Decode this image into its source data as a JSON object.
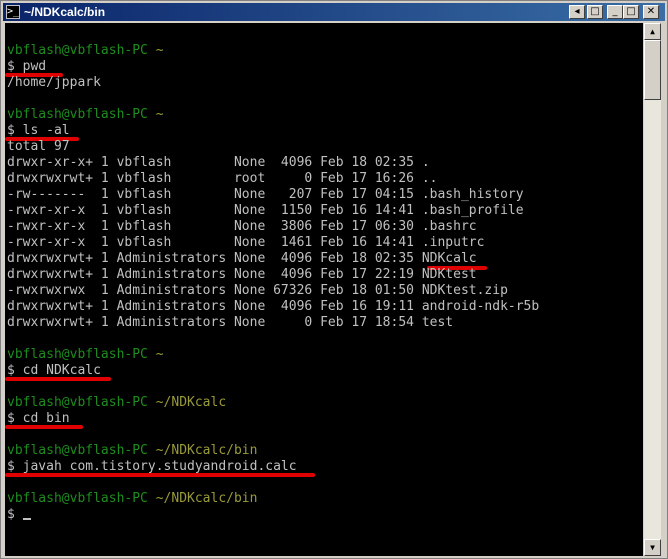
{
  "window": {
    "title": "~/NDKcalc/bin",
    "icon_name": "cygwin-terminal-icon",
    "buttons": {
      "menu": "◂",
      "restore": "□",
      "minimize": "_",
      "maximize": "□",
      "close": "✕"
    }
  },
  "terminal": {
    "colors": {
      "background": "#000000",
      "text": "#C0C0C0",
      "prompt": "#1E8C1E",
      "path": "#9A9A3A",
      "highlight": "#E00000"
    },
    "prompt_user": "vbflash@vbflash-PC",
    "cmd_pwd": "$ pwd",
    "pwd_output": "/home/jppark",
    "cmd_ls": "$ ls -al",
    "ls_total": "total 97",
    "ls_rows": [
      "drwxr-xr-x+ 1 vbflash        None  4096 Feb 18 02:35 .",
      "drwxrwxrwt+ 1 vbflash        root     0 Feb 17 16:26 ..",
      "-rw-------  1 vbflash        None   207 Feb 17 04:15 .bash_history",
      "-rwxr-xr-x  1 vbflash        None  1150 Feb 16 14:41 .bash_profile",
      "-rwxr-xr-x  1 vbflash        None  3806 Feb 17 06:30 .bashrc",
      "-rwxr-xr-x  1 vbflash        None  1461 Feb 16 14:41 .inputrc",
      "drwxrwxrwt+ 1 Administrators None  4096 Feb 18 02:35 NDKcalc",
      "drwxrwxrwt+ 1 Administrators None  4096 Feb 17 22:19 NDKtest",
      "-rwxrwxrwx  1 Administrators None 67326 Feb 18 01:50 NDKtest.zip",
      "drwxrwxrwt+ 1 Administrators None  4096 Feb 16 19:11 android-ndk-r5b",
      "drwxrwxrwt+ 1 Administrators None     0 Feb 17 18:54 test"
    ],
    "path_home": "~",
    "cmd_cd_ndkcalc": "$ cd NDKcalc",
    "path_ndkcalc": "~/NDKcalc",
    "cmd_cd_bin": "$ cd bin",
    "path_bin": "~/NDKcalc/bin",
    "cmd_javah": "$ javah com.tistory.studyandroid.calc",
    "final_prompt": "$ "
  },
  "scrollbar": {
    "up_arrow": "▲",
    "down_arrow": "▼",
    "position": 0.0
  }
}
